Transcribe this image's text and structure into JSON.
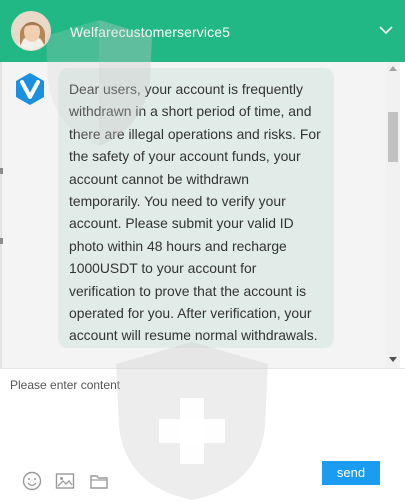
{
  "header": {
    "title": "Welfarecustomerservice5",
    "background": "#22b886",
    "avatar_icon": "agent-avatar",
    "collapse_icon": "chevron-down-icon"
  },
  "chat": {
    "agent_logo_icon": "v-brand-logo",
    "messages": [
      {
        "from": "agent",
        "text": "Dear users, your account is frequently withdrawn in a short period of time, and there are illegal operations and risks. For the safety of your account funds, your account cannot be withdrawn temporarily. You need to verify your account. Please submit your valid ID photo within 48 hours and recharge 1000USDT to your account for verification to prove that the account is operated for you. After verification, your account will resume normal withdrawals."
      }
    ]
  },
  "composer": {
    "placeholder": "Please enter content",
    "tools": [
      "emoji-icon",
      "image-icon",
      "folder-icon"
    ],
    "send_label": "send",
    "send_color": "#1a9cf0"
  }
}
